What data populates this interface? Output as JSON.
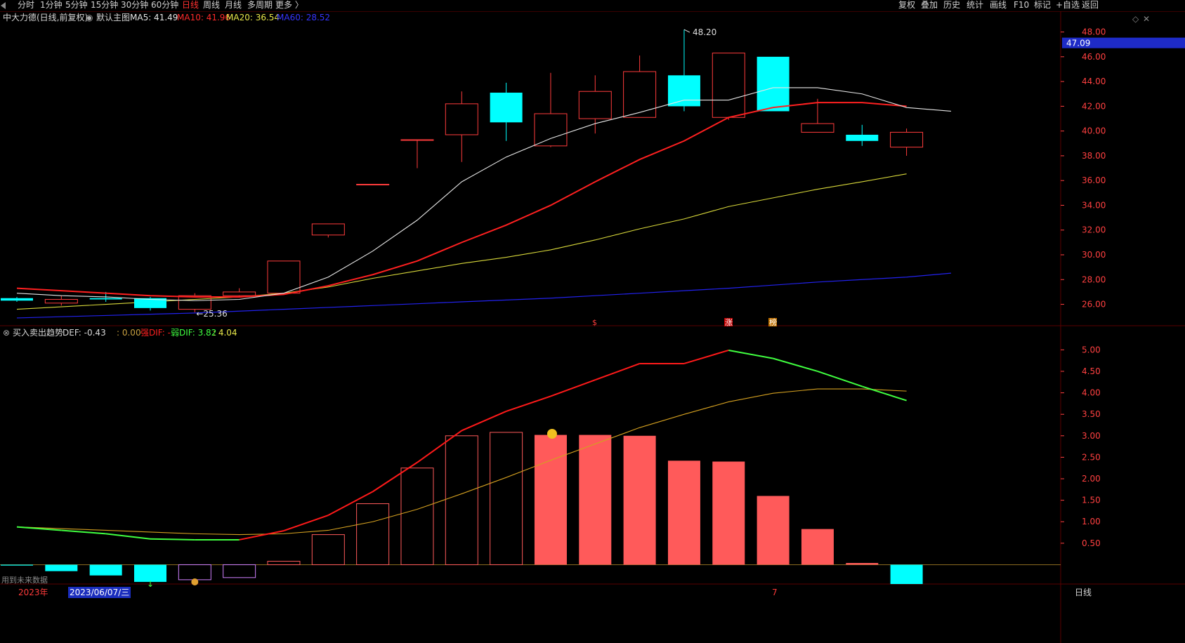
{
  "toolbar": {
    "left_items": [
      "分时",
      "1分钟",
      "5分钟",
      "15分钟",
      "30分钟",
      "60分钟",
      "日线",
      "周线",
      "月线",
      "多周期",
      "更多 〉"
    ],
    "active": "日线",
    "right_items": [
      "复权",
      "叠加",
      "历史",
      "统计",
      "画线",
      "F10",
      "标记",
      "+自选",
      "返回"
    ]
  },
  "main_header": {
    "stock": "中大力德(日线,前复权)",
    "template": "默认主图",
    "ma": [
      {
        "label": "MA5: 41.49",
        "color": "#e6e6e6"
      },
      {
        "label": "MA10: 41.96",
        "color": "#ff2a2a"
      },
      {
        "label": "MA20: 36.54",
        "color": "#e8e84a"
      },
      {
        "label": "MA60: 28.52",
        "color": "#3535ff"
      }
    ]
  },
  "sub_header": {
    "name": "买入卖出趋势",
    "def": "DEF: -0.43",
    "zero": ": 0.00",
    "strong": "强DIF: -",
    "weak": "弱DIF: 3.82",
    "last": ": 4.04"
  },
  "bottom": {
    "future_data": "用到未来数据",
    "year": "2023年",
    "date": "2023/06/07/三",
    "mark7": "7",
    "period": "日线"
  },
  "price_labels": {
    "high": "48.20",
    "low": "25.36",
    "current": "47.09"
  },
  "signals": {
    "s": "$",
    "zhang": "涨",
    "bang": "榜"
  },
  "colors": {
    "up": "#ff3c3c",
    "down": "#00ffff",
    "ma5": "#e6e6e6",
    "ma10": "#ff2020",
    "ma20": "#d8d83a",
    "ma60": "#2222ee",
    "grid": "#5a0000",
    "axis_text": "#ff4040",
    "hist_fill": "#ff5a5a",
    "dif_red": "#ff1a1a",
    "dif_green": "#40ff40",
    "dea": "#d4a020"
  },
  "chart_data": [
    {
      "type": "candlestick",
      "title": "中大力德(日线,前复权)",
      "ylim": [
        24.5,
        48.6
      ],
      "yticks": [
        26,
        28,
        30,
        32,
        34,
        36,
        38,
        40,
        42,
        44,
        46,
        48
      ],
      "ytick_labels": [
        "26.00",
        "28.00",
        "30.00",
        "32.00",
        "34.00",
        "36.00",
        "38.00",
        "40.00",
        "42.00",
        "44.00",
        "46.00",
        "48.00"
      ],
      "candles": [
        {
          "o": 26.5,
          "c": 26.3,
          "h": 26.6,
          "l": 26.2
        },
        {
          "o": 26.1,
          "c": 26.4,
          "h": 26.7,
          "l": 25.9
        },
        {
          "o": 26.5,
          "c": 26.4,
          "h": 27.0,
          "l": 26.2
        },
        {
          "o": 26.5,
          "c": 25.7,
          "h": 26.6,
          "l": 25.5
        },
        {
          "o": 25.6,
          "c": 26.7,
          "h": 26.9,
          "l": 25.36
        },
        {
          "o": 26.7,
          "c": 27.0,
          "h": 27.3,
          "l": 26.6
        },
        {
          "o": 26.9,
          "c": 29.5,
          "h": 29.5,
          "l": 26.8
        },
        {
          "o": 31.6,
          "c": 32.5,
          "h": 32.5,
          "l": 31.4
        },
        {
          "o": 35.7,
          "c": 35.7,
          "h": 35.7,
          "l": 35.7
        },
        {
          "o": 39.3,
          "c": 39.3,
          "h": 39.3,
          "l": 37.0
        },
        {
          "o": 39.7,
          "c": 42.2,
          "h": 43.2,
          "l": 37.5
        },
        {
          "o": 43.1,
          "c": 40.7,
          "h": 43.9,
          "l": 39.2
        },
        {
          "o": 38.8,
          "c": 41.4,
          "h": 44.7,
          "l": 38.7
        },
        {
          "o": 41.0,
          "c": 43.2,
          "h": 44.5,
          "l": 39.8
        },
        {
          "o": 41.1,
          "c": 44.8,
          "h": 46.1,
          "l": 41.1
        },
        {
          "o": 44.5,
          "c": 42.0,
          "h": 48.2,
          "l": 41.6
        },
        {
          "o": 41.1,
          "c": 46.3,
          "h": 46.3,
          "l": 40.9
        },
        {
          "o": 46.0,
          "c": 41.6,
          "h": 46.0,
          "l": 41.6
        },
        {
          "o": 39.9,
          "c": 40.6,
          "h": 42.6,
          "l": 39.9
        },
        {
          "o": 39.7,
          "c": 39.2,
          "h": 40.5,
          "l": 38.8
        },
        {
          "o": 38.7,
          "c": 39.9,
          "h": 40.2,
          "l": 38.0
        }
      ],
      "ma": {
        "MA5": [
          26.9,
          26.7,
          26.6,
          26.4,
          26.3,
          26.4,
          26.9,
          28.2,
          30.3,
          32.8,
          35.9,
          37.9,
          39.4,
          40.6,
          41.5,
          42.5,
          42.5,
          43.5,
          43.5,
          43.0,
          41.9,
          41.6
        ],
        "MA10": [
          27.3,
          27.1,
          26.9,
          26.7,
          26.6,
          26.6,
          26.8,
          27.5,
          28.4,
          29.5,
          31.0,
          32.4,
          34.0,
          35.9,
          37.7,
          39.2,
          41.1,
          41.9,
          42.3,
          42.3,
          42.0
        ],
        "MA20": [
          25.6,
          25.8,
          26.0,
          26.2,
          26.4,
          26.6,
          26.9,
          27.4,
          28.1,
          28.7,
          29.3,
          29.8,
          30.4,
          31.2,
          32.1,
          32.9,
          33.9,
          34.6,
          35.3,
          35.9,
          36.54
        ],
        "MA60": [
          24.9,
          25.0,
          25.1,
          25.2,
          25.3,
          25.45,
          25.6,
          25.75,
          25.9,
          26.05,
          26.2,
          26.35,
          26.5,
          26.7,
          26.9,
          27.1,
          27.3,
          27.55,
          27.8,
          28.0,
          28.2,
          28.52
        ]
      }
    },
    {
      "type": "bar",
      "title": "买入卖出趋势",
      "ylim": [
        -0.45,
        5.3
      ],
      "yticks": [
        0.5,
        1.0,
        1.5,
        2.0,
        2.5,
        3.0,
        3.5,
        4.0,
        4.5,
        5.0
      ],
      "ytick_labels": [
        "0.50",
        "1.00",
        "1.50",
        "2.00",
        "2.50",
        "3.00",
        "3.50",
        "4.00",
        "4.50",
        "5.00"
      ],
      "bars": [
        -0.02,
        -0.15,
        -0.25,
        -0.4,
        -0.35,
        -0.3,
        0.08,
        0.7,
        1.42,
        2.25,
        3.0,
        3.08,
        3.02,
        3.02,
        3.0,
        2.42,
        2.4,
        1.6,
        0.83,
        0.04,
        -0.45
      ],
      "dif": [
        0.88,
        0.8,
        0.72,
        0.6,
        0.58,
        0.58,
        0.79,
        1.15,
        1.7,
        2.38,
        3.12,
        3.57,
        3.92,
        4.3,
        4.68,
        4.68,
        4.99,
        4.8,
        4.5,
        4.15,
        3.82
      ],
      "dea": [
        0.88,
        0.84,
        0.8,
        0.76,
        0.72,
        0.7,
        0.72,
        0.8,
        1.0,
        1.29,
        1.65,
        2.03,
        2.43,
        2.81,
        3.19,
        3.5,
        3.79,
        3.99,
        4.09,
        4.09,
        4.04
      ]
    }
  ]
}
